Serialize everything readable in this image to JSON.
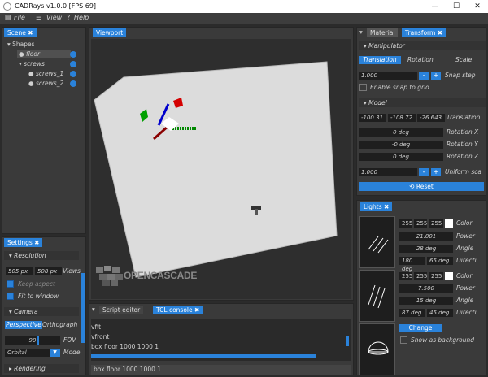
{
  "titlebar": {
    "title": "CADRays v1.0.0 [FPS 69]",
    "min": "—",
    "max": "☐",
    "close": "✕"
  },
  "menu": {
    "file": "File",
    "view": "View",
    "help": "Help"
  },
  "scene": {
    "tab": "Scene",
    "root": "Shapes",
    "items": [
      "floor",
      "screws",
      "screws_1",
      "screws_2"
    ]
  },
  "viewport": {
    "tab": "Viewport",
    "logo": "OPENCASCADE"
  },
  "settings": {
    "tab": "Settings",
    "resolution": "Resolution",
    "w": "505",
    "h": "508",
    "unit": "px",
    "views": "Views",
    "keep": "Keep aspect",
    "fit": "Fit to window",
    "camera": "Camera",
    "persp": "Perspective",
    "ortho": "Orthograph",
    "fov": "90",
    "fov_lbl": "FOV",
    "mode_val": "Orbital",
    "mode_lbl": "Mode",
    "rendering": "Rendering"
  },
  "console": {
    "tab_script": "Script editor",
    "tab_tcl": "TCL console",
    "lines": [
      "vfit",
      "vfront",
      "box floor 1000 1000 1"
    ],
    "input": "box floor 1000 1000 1"
  },
  "transform": {
    "tab_mat": "Material",
    "tab_tr": "Transform",
    "manip": "Manipulator",
    "translation": "Translation",
    "rotation": "Rotation",
    "scale": "Scale",
    "step": "1.000",
    "minus": "-",
    "plus": "+",
    "step_lbl": "Snap step",
    "snap": "Enable snap to grid",
    "model": "Model",
    "tx": "-100.31",
    "ty": "-108.72",
    "tz": "-26.643",
    "tr_lbl": "Translation",
    "rx": "0 deg",
    "ry": "-0 deg",
    "rz": "0 deg",
    "rxl": "Rotation X",
    "ryl": "Rotation Y",
    "rzl": "Rotation Z",
    "us": "1.000",
    "usl": "Uniform sca",
    "reset": "Reset"
  },
  "lights": {
    "tab": "Lights",
    "l1": {
      "c": [
        "255",
        "255",
        "255"
      ],
      "cl": "Color",
      "p": "21.001",
      "pl": "Power",
      "a": "28 deg",
      "al": "Angle",
      "d1": "180 deg",
      "d2": "65 deg",
      "dl": "Directi"
    },
    "l2": {
      "c": [
        "255",
        "255",
        "255"
      ],
      "cl": "Color",
      "p": "7.500",
      "pl": "Power",
      "a": "15 deg",
      "al": "Angle",
      "d1": "87 deg",
      "d2": "45 deg",
      "dl": "Directi"
    },
    "change": "Change",
    "bg": "Show as background"
  }
}
